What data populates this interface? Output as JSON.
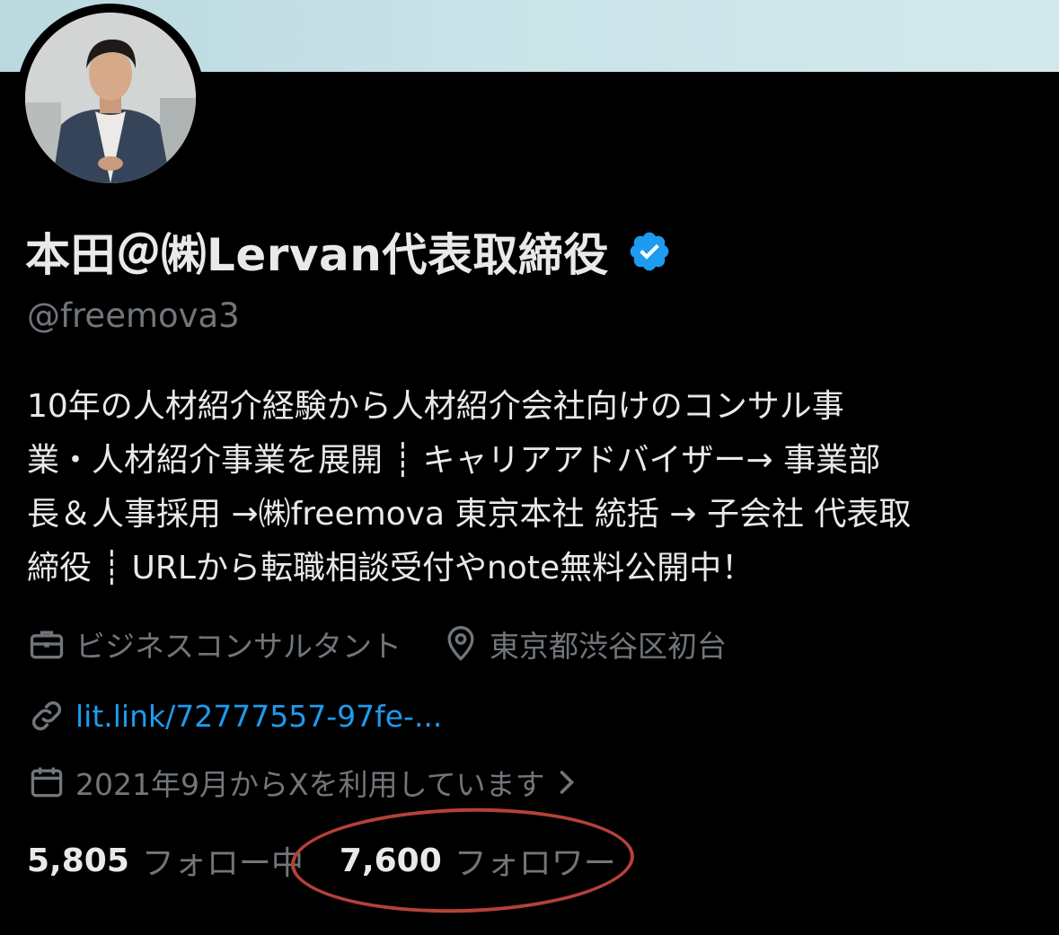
{
  "profile": {
    "display_name": "本田＠㈱Lervan代表取締役",
    "handle": "@freemova3",
    "bio_lines": [
      "10年の人材紹介経験から人材紹介会社向けのコンサル事",
      "業・人材紹介事業を展開 ┊ キャリアアドバイザー→ 事業部",
      "長＆人事採用 →㈱freemova 東京本社 統括 → 子会社 代表取",
      "締役 ┊ URLから転職相談受付やnote無料公開中！"
    ],
    "category": "ビジネスコンサルタント",
    "location": "東京都渋谷区初台",
    "link": "lit.link/72777557-97fe-...",
    "joined": "2021年9月からXを利用しています",
    "following_count": "5,805",
    "following_label": "フォロー中",
    "followers_count": "7,600",
    "followers_label": "フォロワー"
  },
  "icons": {
    "verified": "verified-badge-icon",
    "category": "briefcase-icon",
    "location": "location-pin-icon",
    "link": "link-icon",
    "joined": "calendar-icon",
    "joined_more": "chevron-right-icon"
  },
  "colors": {
    "background": "#000000",
    "primary_text": "#e7e9ea",
    "secondary_text": "#71767b",
    "link": "#1d9bf0",
    "verified": "#1d9bf0",
    "annotation": "#b5413a"
  }
}
